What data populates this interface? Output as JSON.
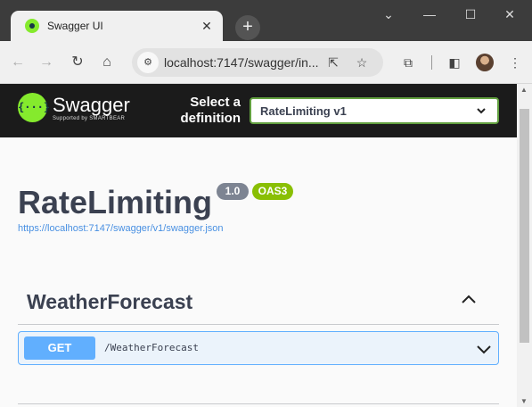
{
  "browser": {
    "tab_title": "Swagger UI",
    "tab_close": "✕",
    "new_tab": "+",
    "url": "localhost:7147/swagger/in...",
    "window_controls": {
      "minimize": "⌄",
      "min": "—",
      "maximize": "☐",
      "close": "✕"
    }
  },
  "swagger_bar": {
    "logo_name": "Swagger",
    "logo_sub": "Supported by SMARTBEAR",
    "logo_glyph": "{···}",
    "select_label": "Select a definition",
    "definition": "RateLimiting v1"
  },
  "info": {
    "title": "RateLimiting",
    "version": "1.0",
    "oas": "OAS3",
    "spec_url": "https://localhost:7147/swagger/v1/swagger.json"
  },
  "tag": {
    "name": "WeatherForecast",
    "operations": [
      {
        "method": "GET",
        "path": "/WeatherForecast"
      }
    ]
  },
  "colors": {
    "get": "#61affe",
    "brand": "#85ea2d",
    "select_border": "#62a03f"
  }
}
